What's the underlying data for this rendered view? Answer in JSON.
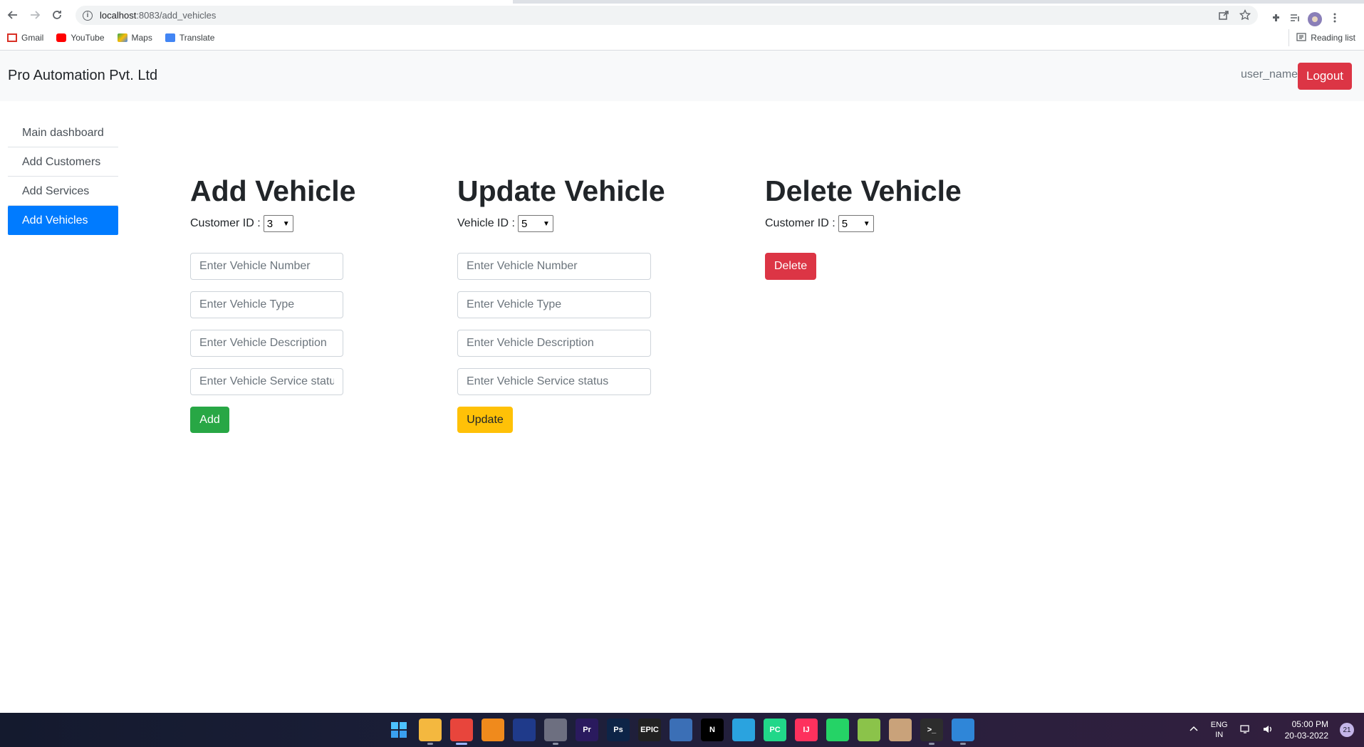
{
  "browser": {
    "url_host": "localhost",
    "url_path": ":8083/add_vehicles",
    "bookmarks": [
      "Gmail",
      "YouTube",
      "Maps",
      "Translate"
    ],
    "reading_list": "Reading list"
  },
  "navbar": {
    "brand": "Pro Automation Pvt. Ltd",
    "user_name": "user_name",
    "logout_label": "Logout"
  },
  "sidebar": {
    "items": [
      {
        "label": "Main dashboard"
      },
      {
        "label": "Add Customers"
      },
      {
        "label": "Add Services"
      },
      {
        "label": "Add Vehicles"
      }
    ],
    "active_index": 3
  },
  "add_vehicle": {
    "title": "Add Vehicle",
    "id_label": "Customer ID :",
    "id_value": "3",
    "placeholders": {
      "number": "Enter Vehicle Number",
      "type": "Enter Vehicle Type",
      "description": "Enter Vehicle Description",
      "status": "Enter Vehicle Service status"
    },
    "button_label": "Add"
  },
  "update_vehicle": {
    "title": "Update Vehicle",
    "id_label": "Vehicle ID :",
    "id_value": "5",
    "placeholders": {
      "number": "Enter Vehicle Number",
      "type": "Enter Vehicle Type",
      "description": "Enter Vehicle Description",
      "status": "Enter Vehicle Service status"
    },
    "button_label": "Update"
  },
  "delete_vehicle": {
    "title": "Delete Vehicle",
    "id_label": "Customer ID :",
    "id_value": "5",
    "button_label": "Delete"
  },
  "taskbar": {
    "apps": [
      {
        "name": "start-icon",
        "label": "",
        "color": "#3b8fea"
      },
      {
        "name": "file-explorer-icon",
        "label": "",
        "color": "#f4b83f"
      },
      {
        "name": "chrome-icon",
        "label": "",
        "color": "#e8453c"
      },
      {
        "name": "fl-studio-icon",
        "label": "",
        "color": "#f08a1c"
      },
      {
        "name": "firefox-icon",
        "label": "",
        "color": "#1f3a8a"
      },
      {
        "name": "app-icon",
        "label": "",
        "color": "#6d6f80"
      },
      {
        "name": "premiere-icon",
        "label": "Pr",
        "color": "#2a1a5e"
      },
      {
        "name": "photoshop-icon",
        "label": "Ps",
        "color": "#0d2447"
      },
      {
        "name": "epic-games-icon",
        "label": "EPIC",
        "color": "#222222"
      },
      {
        "name": "virtualbox-icon",
        "label": "",
        "color": "#3b6fb6"
      },
      {
        "name": "netflix-icon",
        "label": "N",
        "color": "#000000"
      },
      {
        "name": "telegram-icon",
        "label": "",
        "color": "#2aa3df"
      },
      {
        "name": "pycharm-icon",
        "label": "PC",
        "color": "#21d789"
      },
      {
        "name": "intellij-icon",
        "label": "IJ",
        "color": "#fe315d"
      },
      {
        "name": "whatsapp-icon",
        "label": "",
        "color": "#25d366"
      },
      {
        "name": "bluestacks-icon",
        "label": "",
        "color": "#8bc34a"
      },
      {
        "name": "paint-icon",
        "label": "",
        "color": "#c9a27a"
      },
      {
        "name": "terminal-icon",
        "label": ">_",
        "color": "#2d2d2d"
      },
      {
        "name": "photos-icon",
        "label": "",
        "color": "#2f86d8"
      }
    ],
    "lang_top": "ENG",
    "lang_bottom": "IN",
    "time": "05:00 PM",
    "date": "20-03-2022",
    "notifications": "21"
  }
}
